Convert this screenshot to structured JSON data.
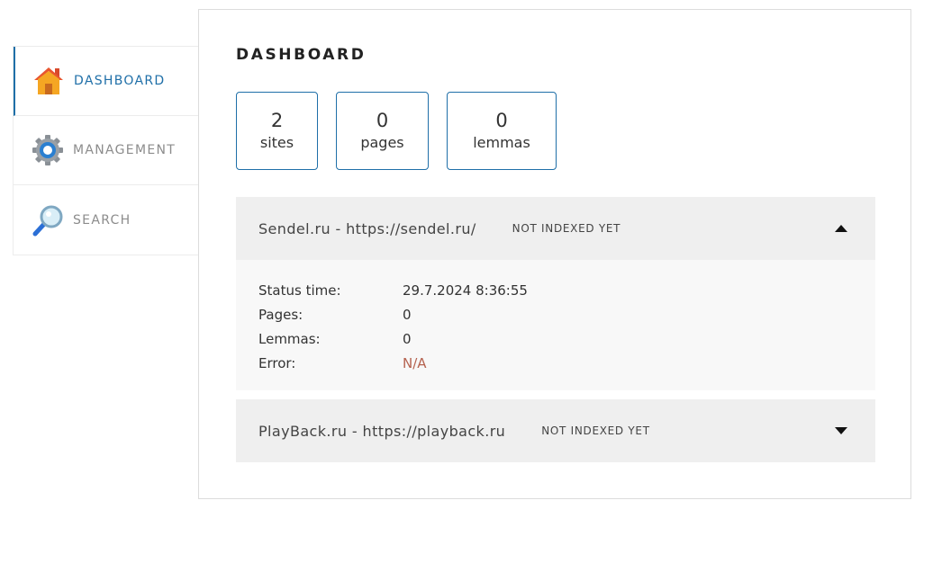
{
  "sidebar": {
    "items": [
      {
        "label": "DASHBOARD",
        "icon": "home-icon",
        "active": true
      },
      {
        "label": "MANAGEMENT",
        "icon": "gear-icon",
        "active": false
      },
      {
        "label": "SEARCH",
        "icon": "magnifier-icon",
        "active": false
      }
    ]
  },
  "main": {
    "title": "DASHBOARD",
    "stats": [
      {
        "value": "2",
        "label": "sites"
      },
      {
        "value": "0",
        "label": "pages"
      },
      {
        "value": "0",
        "label": "lemmas"
      }
    ],
    "sites": [
      {
        "name": "Sendel.ru - https://sendel.ru/",
        "status": "NOT INDEXED YET",
        "expanded": true,
        "toggle_icon": "caret-up-icon",
        "details": [
          {
            "key": "Status time:",
            "value": "29.7.2024 8:36:55"
          },
          {
            "key": "Pages:",
            "value": "0"
          },
          {
            "key": "Lemmas:",
            "value": "0"
          },
          {
            "key": "Error:",
            "value": "N/A"
          }
        ]
      },
      {
        "name": "PlayBack.ru - https://playback.ru",
        "status": "NOT INDEXED YET",
        "expanded": false,
        "toggle_icon": "caret-down-icon"
      }
    ]
  },
  "colors": {
    "accent": "#1f6fa8",
    "error": "#b5624f",
    "header_bg": "#efefef",
    "body_bg": "#f8f8f8"
  }
}
